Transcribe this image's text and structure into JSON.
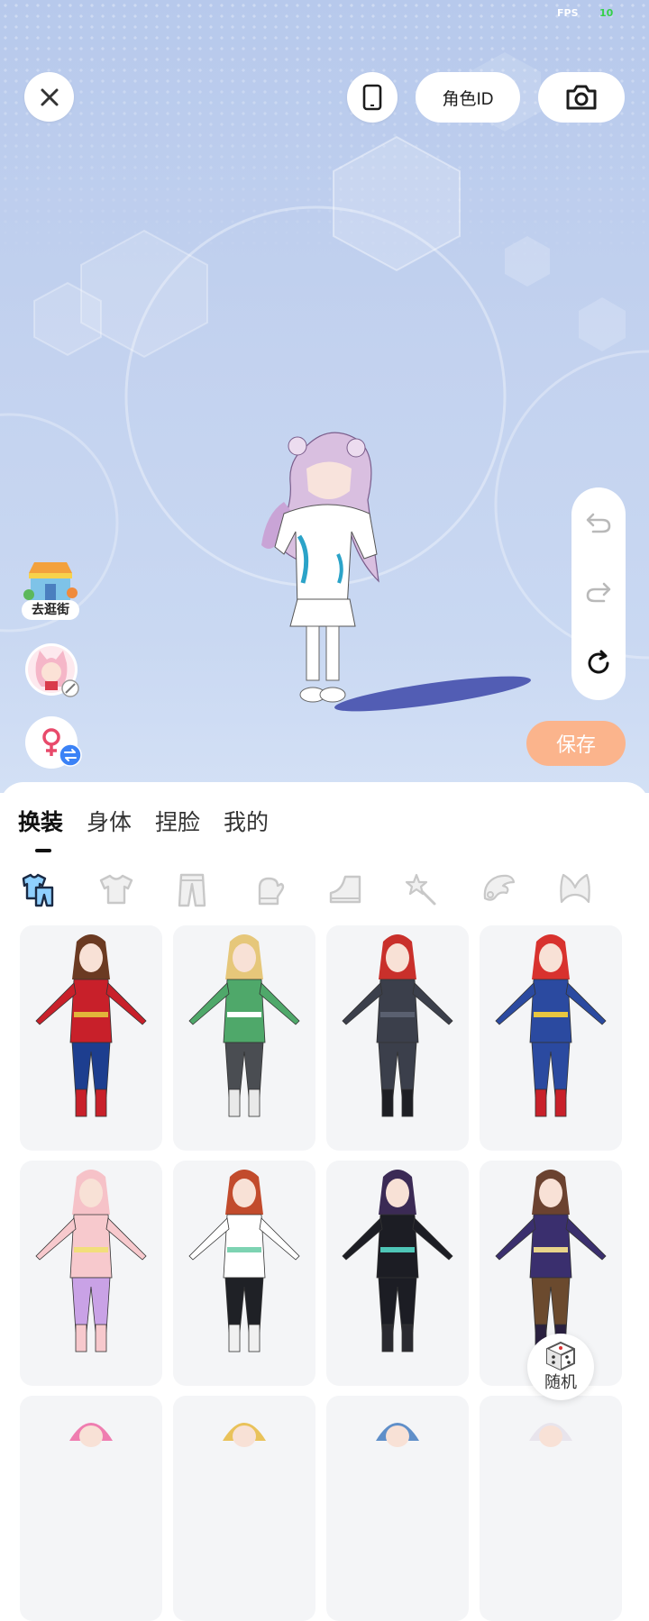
{
  "status": {
    "fps_label": "FPS",
    "fps_value": "10"
  },
  "top_bar": {
    "close_icon": "close-icon",
    "device_icon": "phone-icon",
    "role_id_label": "角色ID",
    "camera_icon": "camera-icon"
  },
  "side_tools": {
    "undo_icon": "undo-icon",
    "redo_icon": "redo-icon",
    "reset_icon": "reset-icon"
  },
  "left_tools": {
    "shop_label": "去逛街",
    "avatar_icon": "avatar-icon",
    "gender_icon": "female-symbol-icon",
    "swap_icon": "swap-icon"
  },
  "save_label": "保存",
  "tabs": [
    {
      "label": "换装",
      "active": true
    },
    {
      "label": "身体",
      "active": false
    },
    {
      "label": "捏脸",
      "active": false
    },
    {
      "label": "我的",
      "active": false
    }
  ],
  "categories": [
    "outfit-set-icon",
    "top-icon",
    "pants-icon",
    "gloves-icon",
    "shoes-icon",
    "wand-icon",
    "wings-icon",
    "ears-icon"
  ],
  "outfits": [
    {
      "name": "wonder-outfit",
      "hair": "#6b3a22",
      "top": "#c8202a",
      "bottom": "#1d3e8f",
      "boots": "#c8202a",
      "accent": "#e2b53a"
    },
    {
      "name": "green-kimono-outfit",
      "hair": "#e6c77a",
      "top": "#4fa86a",
      "bottom": "#4a4d52",
      "boots": "#e9e9e9",
      "accent": "#ffffff"
    },
    {
      "name": "black-suit-outfit",
      "hair": "#c9302b",
      "top": "#3b3f4b",
      "bottom": "#3b3f4b",
      "boots": "#1e1f24",
      "accent": "#5a6070"
    },
    {
      "name": "captain-outfit",
      "hair": "#d8322e",
      "top": "#2b4aa0",
      "bottom": "#2b4aa0",
      "boots": "#c8202a",
      "accent": "#e8c640"
    },
    {
      "name": "pink-cat-outfit",
      "hair": "#f6c2c8",
      "top": "#f7c9cd",
      "bottom": "#c9a2e6",
      "boots": "#f7c9cd",
      "accent": "#f2de7a"
    },
    {
      "name": "sport-outfit",
      "hair": "#c24b2c",
      "top": "#ffffff",
      "bottom": "#1f2126",
      "boots": "#f0f0f0",
      "accent": "#7dd3b2"
    },
    {
      "name": "gothic-dress-outfit",
      "hair": "#3b2a55",
      "top": "#1c1d24",
      "bottom": "#1c1d24",
      "boots": "#2a2a30",
      "accent": "#4fc6b8"
    },
    {
      "name": "wizard-robe-outfit",
      "hair": "#6b4230",
      "top": "#3a2f6e",
      "bottom": "#6b4a2e",
      "boots": "#2a2040",
      "accent": "#e8d48a"
    },
    {
      "name": "pink-hair-outfit",
      "hair": "#ef7db0",
      "top": "#ffffff",
      "bottom": "#ffffff",
      "boots": "#ffffff",
      "accent": "#ffffff"
    },
    {
      "name": "blonde-spiky-outfit",
      "hair": "#e9c25a",
      "top": "#ffffff",
      "bottom": "#ffffff",
      "boots": "#ffffff",
      "accent": "#ffffff"
    },
    {
      "name": "blue-hair-outfit",
      "hair": "#5f8fc9",
      "top": "#ffffff",
      "bottom": "#ffffff",
      "boots": "#ffffff",
      "accent": "#ffffff"
    },
    {
      "name": "white-hair-outfit",
      "hair": "#e8e4ec",
      "top": "#ffffff",
      "bottom": "#ffffff",
      "boots": "#ffffff",
      "accent": "#ffffff"
    }
  ],
  "random_label": "随机",
  "colors": {
    "save_bg": "#fbb48c",
    "scene_top": "#b7c9ec",
    "scene_bottom": "#d3e0f5",
    "swap_badge": "#3b82f6"
  }
}
